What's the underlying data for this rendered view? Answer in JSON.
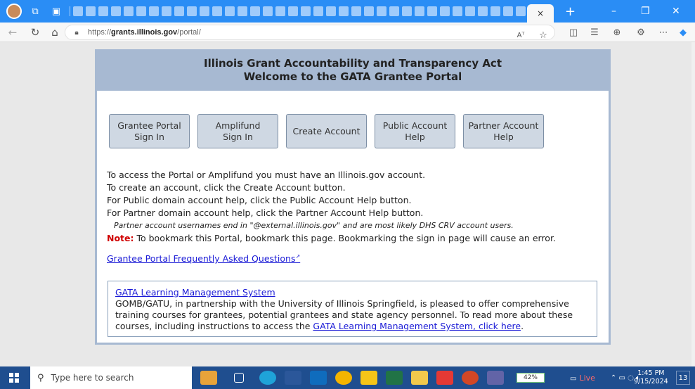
{
  "browser": {
    "url": "https://grants.illinois.gov/portal/",
    "url_display_prefix": "https://",
    "url_display_host": "grants.illinois.gov",
    "url_display_path": "/portal/",
    "tab_close": "×",
    "new_tab": "+",
    "read_aloud": "Aᵀ"
  },
  "header": {
    "line1": "Illinois Grant Accountability and Transparency Act",
    "line2": "Welcome to the GATA Grantee Portal"
  },
  "buttons": [
    {
      "label": "Grantee Portal\nSign In"
    },
    {
      "label": "Amplifund\nSign In"
    },
    {
      "label": "Create Account"
    },
    {
      "label": "Public Account\nHelp"
    },
    {
      "label": "Partner Account\nHelp"
    }
  ],
  "instructions": [
    "To access the Portal or Amplifund you must have an Illinois.gov account.",
    "To create an account, click the Create Account button.",
    "For Public domain account help, click the Public Account Help button.",
    "For Partner domain account help, click the Partner Account Help button."
  ],
  "partner_note": "Partner account usernames end in \"@external.illinois.gov\" and are most likely DHS CRV account users.",
  "note": {
    "label": "Note:",
    "text": " To bookmark this Portal, bookmark this page. Bookmarking the sign in page will cause an error."
  },
  "faq_link": "Grantee Portal Frequently Asked Questions",
  "faq_ext": "↗",
  "lms": {
    "title": "GATA Learning Management System",
    "text": "GOMB/GATU, in partnership with the University of Illinois Springfield, is pleased to offer comprehensive training courses for grantees, potential grantees and state agency personnel. To read more about these courses, including instructions to access the ",
    "link": "GATA Learning Management System, click here",
    "end": "."
  },
  "taskbar": {
    "search_placeholder": "Type here to search",
    "battery": "42%",
    "live": "Live",
    "time": "1:45 PM",
    "date": "9/15/2024",
    "notifications": "13"
  },
  "colors": {
    "tab_bar": "#2a8df5",
    "portal_blue": "#a7b9d2",
    "button_fill": "#cfd8e3",
    "link": "#1a1ad6",
    "note_red": "#d00000",
    "taskbar": "#1f4e8f"
  }
}
